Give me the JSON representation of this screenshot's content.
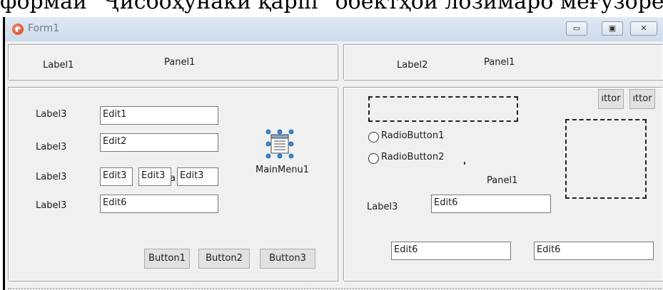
{
  "caption": "формаи \"Ҷисбоҳунаки қаріп\" обектҳои лозимаро меғузорем",
  "window": {
    "title": "Form1",
    "minimize": "▭",
    "maximize": "▣",
    "close": "✕"
  },
  "top_left_panel": {
    "label": "Label1",
    "caption": "Panel1"
  },
  "top_right_panel": {
    "label": "Label2",
    "caption": "Panel1"
  },
  "left_panel": {
    "rows": [
      {
        "label": "Label3",
        "edit": "Edit1"
      },
      {
        "label": "Label3",
        "edit": "Edit2"
      },
      {
        "label": "Label3",
        "edits": [
          "Edit3",
          "Edit3",
          "Edit3"
        ],
        "behind": "a"
      },
      {
        "label": "Label3",
        "edit": "Edit6"
      }
    ],
    "main_menu": "MainMenu1",
    "buttons": [
      "Button1",
      "Button2",
      "Button3"
    ]
  },
  "right_panel": {
    "radio1": "RadioButton1",
    "radio2": "RadioButton2",
    "caption": "Panel1",
    "label": "Label3",
    "edit": "Edit6",
    "small_buttons": [
      "ıttor",
      "ıttor"
    ],
    "bottom_edits": [
      "Edit6",
      "Edit6"
    ]
  }
}
